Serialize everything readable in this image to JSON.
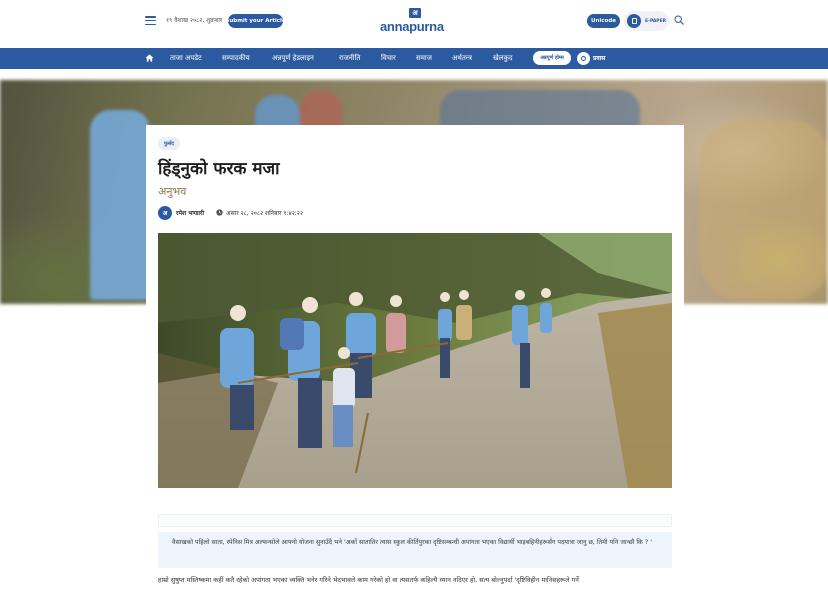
{
  "header": {
    "date": "१९ वैशाख २०८२, शुक्रबार",
    "submit_label": "Submit your Article",
    "logo_mark": "अ",
    "logo_text": "annapurna",
    "unicode_label": "Unicode",
    "epaper_label": "E-PAPER"
  },
  "nav": {
    "items": [
      "ताजा अपडेट",
      "सम्पादकीय",
      "अन्नपूर्ण हेडलाइन",
      "राजनीति",
      "विचार",
      "समाज",
      "अर्थतन्त्र",
      "खेलकुद"
    ],
    "special_label": "अन्नपूर्ण होम्स",
    "live_label": "प्रवास"
  },
  "article": {
    "category": "फुर्सद",
    "title": "हिंड्नुको फरक मजा",
    "subtitle": "अनुभव",
    "author_initial": "अ",
    "author": "रमेश भण्डारी",
    "published": "असार २८, २०८२ शनिबार ९:४२:२२",
    "quote": "वैसाखको पहिलो साता, स्पेनिस मित्र अल्फन्सोले आफ्नो योजना सुनाउँदै भने 'अर्को सातातिर त्यास स्कुल कीर्तिपुरका दृष्टिसम्बन्धी अपांगता भएका विद्यार्थी भाइबहिनीहरूसँग पदयात्रा जानु छ, तिमी पनि जान्छौ कि ? '",
    "body_first_line": "हाम्रो सुषुप्त मस्तिष्कमा कहीं कतै रहेको अपांगता भएका व्यक्ति भनेर गरिने भेदभावले काम गरेको हो वा त्यसतर्फ कहिल्यै ध्यान नदिएर हो, सत्य बोल्नुपर्दा 'दृष्टिविहीन मानिसहरूले गर्ने"
  },
  "colors": {
    "brand": "#2c5aa0",
    "quote_bg": "#eef4fb",
    "subtitle": "#8a7a55"
  },
  "icons": [
    "hamburger-icon",
    "search-icon",
    "home-icon",
    "epaper-icon",
    "live-icon",
    "clock-icon"
  ]
}
